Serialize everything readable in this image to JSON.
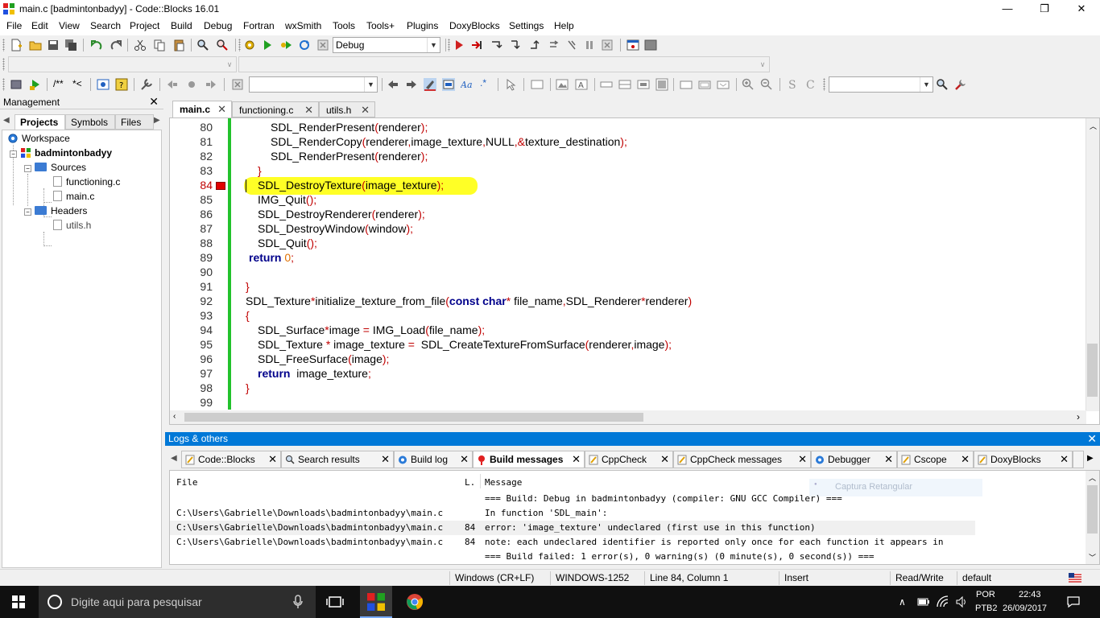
{
  "window": {
    "title": "main.c [badmintonbadyy] - Code::Blocks 16.01",
    "min": "—",
    "max": "❐",
    "close": "✕"
  },
  "menu": [
    "File",
    "Edit",
    "View",
    "Search",
    "Project",
    "Build",
    "Debug",
    "Fortran",
    "wxSmith",
    "Tools",
    "Tools+",
    "Plugins",
    "DoxyBlocks",
    "Settings",
    "Help"
  ],
  "toolbar": {
    "build_target": "Debug",
    "doxy_comment": "/**",
    "doxy_line": "*<",
    "regex_label": ".*"
  },
  "management": {
    "title": "Management",
    "tabs": [
      "Projects",
      "Symbols",
      "Files"
    ],
    "tree": {
      "workspace": "Workspace",
      "project": "badmintonbadyy",
      "sources": "Sources",
      "source_files": [
        "functioning.c",
        "main.c"
      ],
      "headers": "Headers",
      "header_files": [
        "utils.h"
      ]
    }
  },
  "editor": {
    "tabs": [
      "main.c",
      "functioning.c",
      "utils.h"
    ],
    "active_tab": "main.c",
    "line_numbers": [
      "80",
      "81",
      "82",
      "83",
      "84",
      "85",
      "86",
      "87",
      "88",
      "89",
      "90",
      "91",
      "92",
      "93",
      "94",
      "95",
      "96",
      "97",
      "98",
      "99"
    ],
    "current_line": "84"
  },
  "logs": {
    "title": "Logs & others",
    "tabs": [
      "Code::Blocks",
      "Search results",
      "Build log",
      "Build messages",
      "CppCheck",
      "CppCheck messages",
      "Debugger",
      "Cscope",
      "DoxyBlocks"
    ],
    "active_tab": "Build messages",
    "columns": {
      "file": "File",
      "line": "L.",
      "message": "Message"
    },
    "rows": [
      {
        "file": "",
        "line": "",
        "message": "=== Build: Debug in badmintonbadyy (compiler: GNU GCC Compiler) ==="
      },
      {
        "file": "C:\\Users\\Gabrielle\\Downloads\\badmintonbadyy\\main.c",
        "line": "",
        "message": "In function 'SDL_main':"
      },
      {
        "file": "C:\\Users\\Gabrielle\\Downloads\\badmintonbadyy\\main.c",
        "line": "84",
        "message": "error: 'image_texture' undeclared (first use in this function)"
      },
      {
        "file": "C:\\Users\\Gabrielle\\Downloads\\badmintonbadyy\\main.c",
        "line": "84",
        "message": "note: each undeclared identifier is reported only once for each function it appears in"
      },
      {
        "file": "",
        "line": "",
        "message": "=== Build failed: 1 error(s), 0 warning(s) (0 minute(s), 0 second(s)) ==="
      }
    ],
    "overlay_hint": "Captura Retangular"
  },
  "status": {
    "eol": "Windows (CR+LF)",
    "encoding": "WINDOWS-1252",
    "position": "Line 84, Column 1",
    "mode": "Insert",
    "access": "Read/Write",
    "profile": "default"
  },
  "taskbar": {
    "search_placeholder": "Digite aqui para pesquisar",
    "lang": "POR",
    "layout": "PTB2",
    "time": "22:43",
    "date": "26/09/2017"
  },
  "colors": {
    "accent": "#0078d7",
    "highlight": "#ffff00",
    "changebar": "#22c22c",
    "operator": "#c00000",
    "keyword": "#00008b",
    "number": "#e07000"
  }
}
